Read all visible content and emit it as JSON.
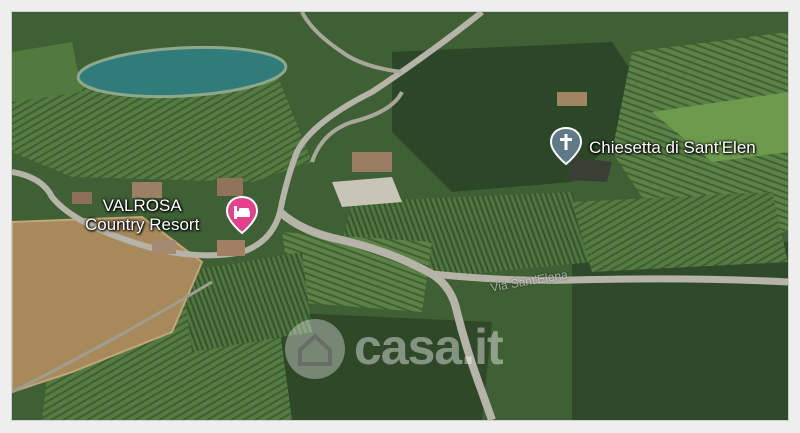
{
  "map": {
    "type": "satellite",
    "places": [
      {
        "id": "valrosa",
        "line1": "VALROSA",
        "line2": "Country Resort",
        "icon": "hotel-bed-icon",
        "pin_color": "#e5408c"
      },
      {
        "id": "chiesetta",
        "name": "Chiesetta di Sant'Elen",
        "icon": "church-cross-icon",
        "pin_color": "#5f7a86"
      }
    ],
    "road_label": "Via Sant'Elena"
  },
  "watermark": {
    "text": "casa.it",
    "icon": "house-logo-icon"
  }
}
